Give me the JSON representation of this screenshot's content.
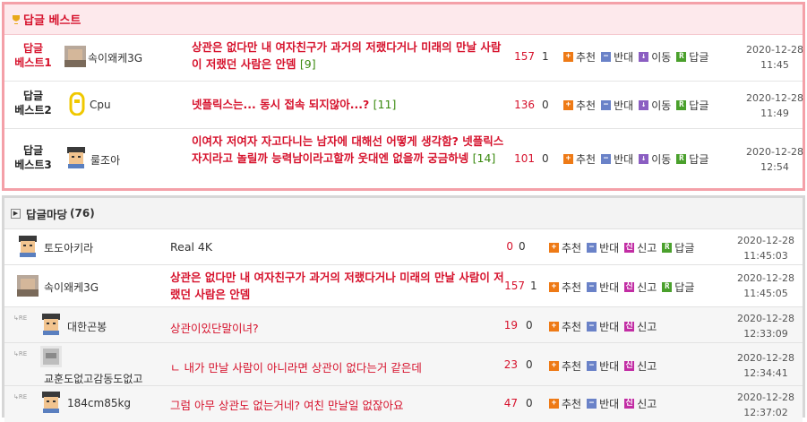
{
  "best": {
    "title": "답글 베스트",
    "rows": [
      {
        "rank": "답글\n베스트1",
        "nick": "속이왜케3G",
        "subject": "상관은 없다만 내 여자친구가 과거의 저랬다거나 미래의 만날 사람이 저랬던 사람은 안뎀",
        "comments": "[9]",
        "count_red": "157",
        "count_gray": "1",
        "date": "2020-12-28",
        "time": "11:45"
      },
      {
        "rank": "답글\n베스트2",
        "nick": "Cpu",
        "subject": "넷플릭스는... 동시 접속 되지않아...?",
        "comments": "[11]",
        "count_red": "136",
        "count_gray": "0",
        "date": "2020-12-28",
        "time": "11:49"
      },
      {
        "rank": "답글\n베스트3",
        "nick": "룰조아",
        "subject": "이여자 저여자 자고다니는 남자에 대해선 어떻게 생각함? 넷플릭스 자지라고 놀릴까 능력남이라고할까 웃대엔 없을까 궁금하넹",
        "comments": "[14]",
        "count_red": "101",
        "count_gray": "0",
        "date": "2020-12-28",
        "time": "12:54"
      }
    ],
    "actions": {
      "recommend": "추천",
      "oppose": "반대",
      "move": "이동",
      "reply": "답글"
    }
  },
  "madang": {
    "title": "답글마당",
    "count": "(76)",
    "rows": [
      {
        "nick": "토도아키라",
        "content": "Real 4K",
        "count_red": "0",
        "count_gray": "0",
        "date": "2020-12-28",
        "time": "11:45:03",
        "reply": false,
        "has_reply": true
      },
      {
        "nick": "속이왜케3G",
        "content": "상관은 없다만 내 여자친구가 과거의 저랬다거나 미래의 만날 사람이 저랬던 사람은 안뎀",
        "count_red": "157",
        "count_gray": "1",
        "date": "2020-12-28",
        "time": "11:45:05",
        "reply": false,
        "has_reply": true
      },
      {
        "nick": "대한곤봉",
        "content": "상관이있단말이녀?",
        "count_red": "19",
        "count_gray": "0",
        "date": "2020-12-28",
        "time": "12:33:09",
        "reply": true,
        "has_reply": false
      },
      {
        "nick": "교훈도없고감동도없고",
        "content": "ㄴ 내가 만날 사람이 아니라면 상관이 없다는거 같은데",
        "count_red": "23",
        "count_gray": "0",
        "date": "2020-12-28",
        "time": "12:34:41",
        "reply": true,
        "has_reply": false
      },
      {
        "nick": "184cm85kg",
        "content": "그럼 아무 상관도 없는거네? 여친 만날일 없잖아요",
        "count_red": "47",
        "count_gray": "0",
        "date": "2020-12-28",
        "time": "12:37:02",
        "reply": true,
        "has_reply": false
      }
    ],
    "actions": {
      "recommend": "추천",
      "oppose": "반대",
      "report": "신고",
      "reply": "답글"
    },
    "re_mark": "RE"
  },
  "icons": {
    "plus": "+",
    "minus": "−",
    "move": "↓",
    "reply": "R",
    "report": "신"
  }
}
